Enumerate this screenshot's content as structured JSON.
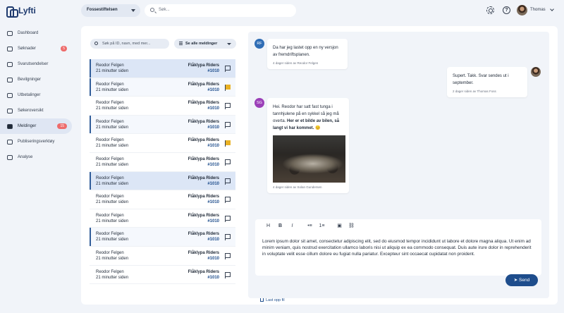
{
  "app": {
    "name": "Lyfti"
  },
  "sidebar": {
    "items": [
      {
        "label": "Dashboard",
        "icon": "home-icon"
      },
      {
        "label": "Søknader",
        "icon": "document-icon",
        "badge": "5"
      },
      {
        "label": "Svarutsendelser",
        "icon": "send-icon"
      },
      {
        "label": "Bevilgninger",
        "icon": "money-icon"
      },
      {
        "label": "Utbetalinger",
        "icon": "wallet-icon"
      },
      {
        "label": "Søkeroversikt",
        "icon": "users-icon"
      },
      {
        "label": "Meldinger",
        "icon": "chat-icon",
        "badge": "15",
        "active": true
      },
      {
        "label": "Publiseringsverktøy",
        "icon": "publish-icon"
      },
      {
        "label": "Analyse",
        "icon": "analytics-icon"
      }
    ]
  },
  "topbar": {
    "org_select": "Fossestiftelsen",
    "search_placeholder": "Søk...",
    "user_name": "Thomas"
  },
  "messages_list": {
    "search_placeholder": "Søk på ID, navn, med mer...",
    "filter_label": "Se alle meldinger",
    "rows": [
      {
        "name": "Reodor Felgen",
        "time": "21 minutter siden",
        "org": "Flåklypa Riders",
        "id": "#1010",
        "flagged": false
      },
      {
        "name": "Reodor Felgen",
        "time": "21 minutter siden",
        "org": "Flåklypa Riders",
        "id": "#1010",
        "flagged": true
      },
      {
        "name": "Reodor Felgen",
        "time": "21 minutter siden",
        "org": "Flåklypa Riders",
        "id": "#1010",
        "flagged": false
      },
      {
        "name": "Reodor Felgen",
        "time": "21 minutter siden",
        "org": "Flåklypa Riders",
        "id": "#1010",
        "flagged": false
      },
      {
        "name": "Reodor Felgen",
        "time": "21 minutter siden",
        "org": "Flåklypa Riders",
        "id": "#1010",
        "flagged": true
      },
      {
        "name": "Reodor Felgen",
        "time": "21 minutter siden",
        "org": "Flåklypa Riders",
        "id": "#1010",
        "flagged": false
      },
      {
        "name": "Reodor Felgen",
        "time": "21 minutter siden",
        "org": "Flåklypa Riders",
        "id": "#1010",
        "flagged": false
      },
      {
        "name": "Reodor Felgen",
        "time": "21 minutter siden",
        "org": "Flåklypa Riders",
        "id": "#1010",
        "flagged": false
      },
      {
        "name": "Reodor Felgen",
        "time": "21 minutter siden",
        "org": "Flåklypa Riders",
        "id": "#1010",
        "flagged": false
      },
      {
        "name": "Reodor Felgen",
        "time": "21 minutter siden",
        "org": "Flåklypa Riders",
        "id": "#1010",
        "flagged": false
      },
      {
        "name": "Reodor Felgen",
        "time": "21 minutter siden",
        "org": "Flåklypa Riders",
        "id": "#1010",
        "flagged": false
      },
      {
        "name": "Reodor Felgen",
        "time": "21 minutter siden",
        "org": "Flåklypa Riders",
        "id": "#1010",
        "flagged": false
      }
    ]
  },
  "conversation": {
    "messages": [
      {
        "initials": "RF",
        "text": "Da har jeg lastet opp en ny versjon av fremdriftsplanen.",
        "meta": "4 dager siden av Reodor Felgen"
      },
      {
        "text": "Supert. Takk. Svar sendes ut i september.",
        "meta": "2 dager siden av Thomas Foss"
      },
      {
        "initials": "SG",
        "text": "Hei. Reodor har satt fast tunga i tannhjulene på en sykkel så jeg må overta.",
        "text_bold": "Her er et bilde av bilen, så langt vi har kommet.",
        "emoji": "😊",
        "meta": "4 dager siden av Solan Gundersen"
      }
    ]
  },
  "composer": {
    "toolbar": [
      "H",
      "B",
      "I",
      "•≡",
      "1≡",
      "▣",
      "⛓"
    ],
    "text": "Lorem ipsum dolor sit amet, consectetur adipiscing elit, sed do eiusmod tempor incididunt ut labore et dolore magna aliqua. Ut enim ad minim veniam, quis nostrud exercitation ullamco laboris nisi ut aliquip ex ea commodo consequat. Duis aute irure dolor in reprehenderit in voluptate velit esse cillum dolore eu fugiat nulla pariatur. Excepteur sint occaecat cupidatat non proident.",
    "upload_label": "Last opp fil",
    "send_label": "Send"
  },
  "colors": {
    "accent": "#1e4d8c",
    "badge": "#ee6b6b",
    "flag": "#e9b124",
    "rf_avatar": "#2f6db5",
    "sg_avatar": "#9b3fb8"
  }
}
